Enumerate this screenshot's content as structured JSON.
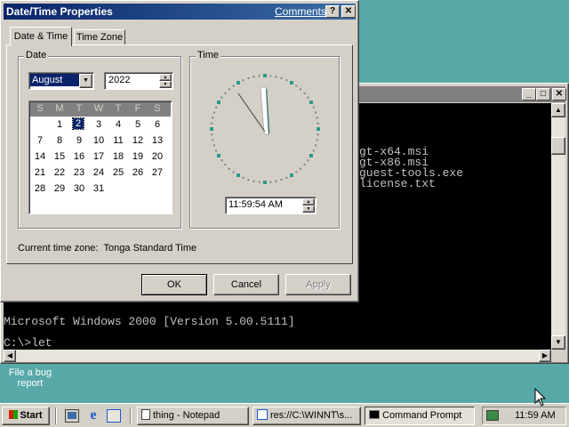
{
  "desktop": {
    "bug_report_label_line1": "File a bug",
    "bug_report_label_line2": "report",
    "background_color": "#58a8a8"
  },
  "console": {
    "lines": [
      "gt-x64.msi",
      "gt-x86.msi",
      "guest-tools.exe",
      "license.txt"
    ],
    "version_line": "Microsoft Windows 2000 [Version 5.00.5111]",
    "prompt_line": "C:\\>let"
  },
  "dialog": {
    "title": "Date/Time Properties",
    "comments_link": "Comments?",
    "help_button": "?",
    "close_button": "✕",
    "tabs": [
      {
        "label": "Date & Time",
        "selected": true
      },
      {
        "label": "Time Zone",
        "selected": false
      }
    ],
    "date_group_label": "Date",
    "month": "August",
    "year": "2022",
    "weekday_headers": [
      "S",
      "M",
      "T",
      "W",
      "T",
      "F",
      "S"
    ],
    "calendar_rows": [
      [
        "",
        "1",
        "2",
        "3",
        "4",
        "5",
        "6"
      ],
      [
        "7",
        "8",
        "9",
        "10",
        "11",
        "12",
        "13"
      ],
      [
        "14",
        "15",
        "16",
        "17",
        "18",
        "19",
        "20"
      ],
      [
        "21",
        "22",
        "23",
        "24",
        "25",
        "26",
        "27"
      ],
      [
        "28",
        "29",
        "30",
        "31",
        "",
        "",
        ""
      ]
    ],
    "selected_day": "2",
    "time_group_label": "Time",
    "time_value": "11:59:54 AM",
    "timezone_label": "Current time zone:",
    "timezone_value": "Tonga Standard Time",
    "ok_label": "OK",
    "cancel_label": "Cancel",
    "apply_label": "Apply"
  },
  "taskbar": {
    "start_label": "Start",
    "tasks": [
      {
        "label": "thing - Notepad",
        "icon": "notepad-icon"
      },
      {
        "label": "res://C:\\WINNT\\s...",
        "icon": "ie-page-icon"
      },
      {
        "label": "Command Prompt",
        "icon": "console-icon"
      }
    ],
    "clock": "11:59 AM"
  },
  "colors": {
    "titlebar_active": "#0a246a",
    "selection": "#0a246a",
    "clock_marks": "#2a9a8a"
  }
}
